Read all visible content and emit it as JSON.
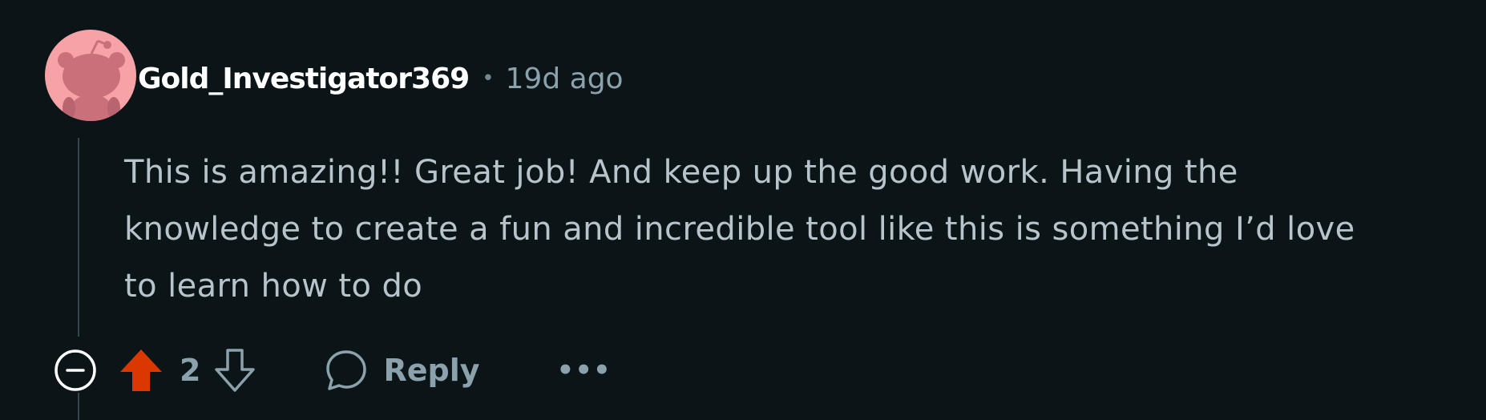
{
  "comment": {
    "author": "Gold_Investigator369",
    "separator": "•",
    "timestamp": "19d ago",
    "body_lines": [
      "This is amazing!! Great job! And keep up the good work. Having the",
      "knowledge to create a fun and incredible tool like this is something I’d love",
      "to learn how to do"
    ]
  },
  "actions": {
    "score": "2",
    "reply_label": "Reply",
    "more_label": "•••"
  },
  "icons": {
    "collapse": "minus-circle-icon",
    "upvote": "upvote-arrow-icon",
    "downvote": "downvote-arrow-icon",
    "reply": "speech-bubble-icon",
    "more": "ellipsis-icon",
    "avatar": "snoo-avatar-icon"
  },
  "colors": {
    "background": "#0b1416",
    "username": "#ffffff",
    "body_text": "#b7c4cb",
    "meta_text": "#8ba2ad",
    "upvote_active": "#d93900",
    "avatar_bg": "#f7a2a7",
    "thread_line": "#33464c"
  }
}
